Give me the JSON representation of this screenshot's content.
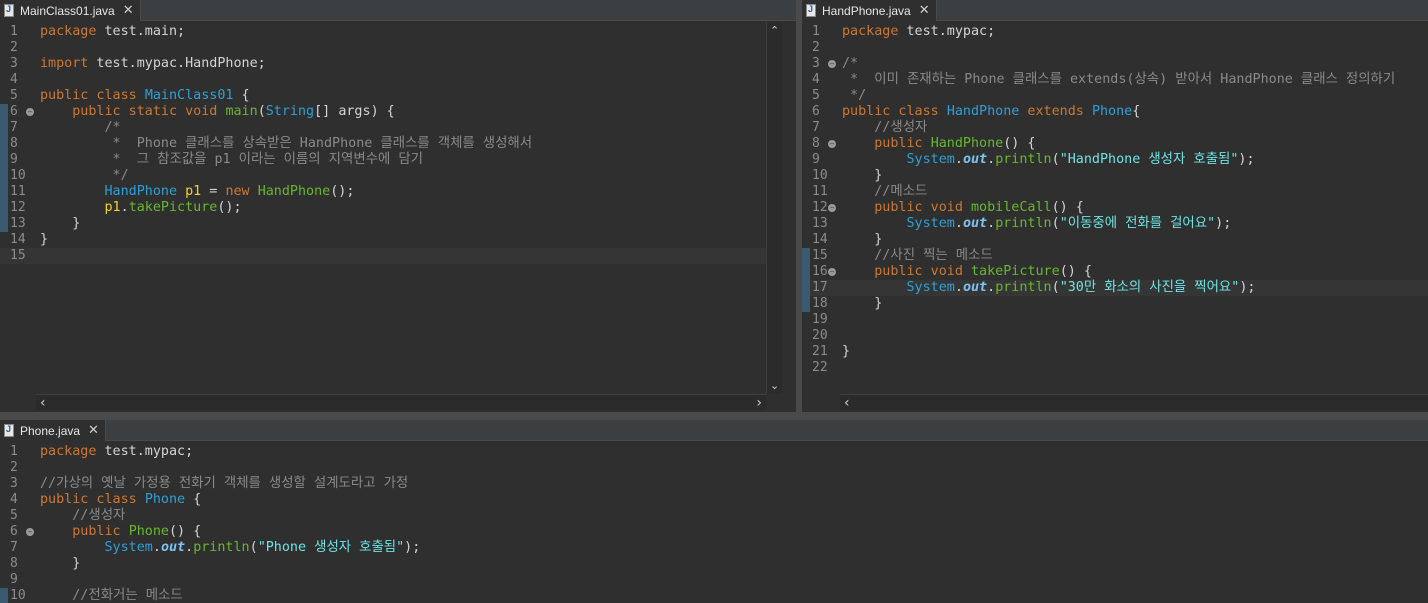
{
  "left_pane": {
    "tab": {
      "label": "MainClass01.java",
      "close": "✕"
    },
    "lines": [
      {
        "n": "1",
        "tokens": [
          {
            "c": "kw",
            "t": "package"
          },
          {
            "c": "pl",
            "t": " test.main;"
          }
        ]
      },
      {
        "n": "2",
        "tokens": []
      },
      {
        "n": "3",
        "tokens": [
          {
            "c": "kw",
            "t": "import"
          },
          {
            "c": "pl",
            "t": " test.mypac.HandPhone;"
          }
        ]
      },
      {
        "n": "4",
        "tokens": []
      },
      {
        "n": "5",
        "tokens": [
          {
            "c": "kw",
            "t": "public class "
          },
          {
            "c": "ty",
            "t": "MainClass01"
          },
          {
            "c": "pl",
            "t": " {"
          }
        ]
      },
      {
        "n": "6",
        "fold": true,
        "mark": true,
        "tokens": [
          {
            "c": "pl",
            "t": "    "
          },
          {
            "c": "kw",
            "t": "public static void "
          },
          {
            "c": "fn",
            "t": "main"
          },
          {
            "c": "pl",
            "t": "("
          },
          {
            "c": "ty",
            "t": "String"
          },
          {
            "c": "pl",
            "t": "[] "
          },
          {
            "c": "id",
            "t": "args"
          },
          {
            "c": "pl",
            "t": ") {"
          }
        ]
      },
      {
        "n": "7",
        "mark": true,
        "tokens": [
          {
            "c": "cm",
            "t": "        /*"
          }
        ]
      },
      {
        "n": "8",
        "mark": true,
        "tokens": [
          {
            "c": "cm",
            "t": "         *  Phone 클래스를 상속받은 HandPhone 클래스를 객체를 생성해서"
          }
        ]
      },
      {
        "n": "9",
        "mark": true,
        "tokens": [
          {
            "c": "cm",
            "t": "         *  그 참조값을 p1 이라는 이름의 지역변수에 담기"
          }
        ]
      },
      {
        "n": "10",
        "mark": true,
        "tokens": [
          {
            "c": "cm",
            "t": "         */"
          }
        ]
      },
      {
        "n": "11",
        "mark": true,
        "tokens": [
          {
            "c": "pl",
            "t": "        "
          },
          {
            "c": "ty",
            "t": "HandPhone"
          },
          {
            "c": "pl",
            "t": " "
          },
          {
            "c": "vr",
            "t": "p1"
          },
          {
            "c": "pl",
            "t": " = "
          },
          {
            "c": "kw",
            "t": "new "
          },
          {
            "c": "fn",
            "t": "HandPhone"
          },
          {
            "c": "pl",
            "t": "();"
          }
        ]
      },
      {
        "n": "12",
        "mark": true,
        "tokens": [
          {
            "c": "pl",
            "t": "        "
          },
          {
            "c": "vr",
            "t": "p1"
          },
          {
            "c": "pl",
            "t": "."
          },
          {
            "c": "fn",
            "t": "takePicture"
          },
          {
            "c": "pl",
            "t": "();"
          }
        ]
      },
      {
        "n": "13",
        "mark": true,
        "tokens": [
          {
            "c": "pl",
            "t": "    }"
          }
        ]
      },
      {
        "n": "14",
        "tokens": [
          {
            "c": "pl",
            "t": "}"
          }
        ]
      },
      {
        "n": "15",
        "current": true,
        "tokens": []
      }
    ]
  },
  "right_pane": {
    "tab": {
      "label": "HandPhone.java",
      "close": "✕"
    },
    "lines": [
      {
        "n": "1",
        "tokens": [
          {
            "c": "kw",
            "t": "package"
          },
          {
            "c": "pl",
            "t": " test.mypac;"
          }
        ]
      },
      {
        "n": "2",
        "tokens": []
      },
      {
        "n": "3",
        "fold": true,
        "tokens": [
          {
            "c": "cm",
            "t": "/*"
          }
        ]
      },
      {
        "n": "4",
        "tokens": [
          {
            "c": "cm",
            "t": " *  이미 존재하는 Phone 클래스를 extends(상속) 받아서 HandPhone 클래스 정의하기"
          }
        ]
      },
      {
        "n": "5",
        "tokens": [
          {
            "c": "cm",
            "t": " */"
          }
        ]
      },
      {
        "n": "6",
        "tokens": [
          {
            "c": "kw",
            "t": "public class "
          },
          {
            "c": "ty",
            "t": "HandPhone"
          },
          {
            "c": "kw",
            "t": " extends "
          },
          {
            "c": "ty",
            "t": "Phone"
          },
          {
            "c": "pl",
            "t": "{"
          }
        ]
      },
      {
        "n": "7",
        "tokens": [
          {
            "c": "cm",
            "t": "    //생성자"
          }
        ]
      },
      {
        "n": "8",
        "fold": true,
        "tokens": [
          {
            "c": "pl",
            "t": "    "
          },
          {
            "c": "kw",
            "t": "public "
          },
          {
            "c": "fn",
            "t": "HandPhone"
          },
          {
            "c": "pl",
            "t": "() {"
          }
        ]
      },
      {
        "n": "9",
        "tokens": [
          {
            "c": "pl",
            "t": "        "
          },
          {
            "c": "ty",
            "t": "System"
          },
          {
            "c": "pl",
            "t": "."
          },
          {
            "c": "it",
            "t": "out"
          },
          {
            "c": "pl",
            "t": "."
          },
          {
            "c": "fn",
            "t": "println"
          },
          {
            "c": "pl",
            "t": "("
          },
          {
            "c": "st",
            "t": "\"HandPhone 생성자 호출됨\""
          },
          {
            "c": "pl",
            "t": ");"
          }
        ]
      },
      {
        "n": "10",
        "tokens": [
          {
            "c": "pl",
            "t": "    }"
          }
        ]
      },
      {
        "n": "11",
        "tokens": [
          {
            "c": "cm",
            "t": "    //메소드"
          }
        ]
      },
      {
        "n": "12",
        "fold": true,
        "tokens": [
          {
            "c": "pl",
            "t": "    "
          },
          {
            "c": "kw",
            "t": "public void "
          },
          {
            "c": "fn",
            "t": "mobileCall"
          },
          {
            "c": "pl",
            "t": "() {"
          }
        ]
      },
      {
        "n": "13",
        "tokens": [
          {
            "c": "pl",
            "t": "        "
          },
          {
            "c": "ty",
            "t": "System"
          },
          {
            "c": "pl",
            "t": "."
          },
          {
            "c": "it",
            "t": "out"
          },
          {
            "c": "pl",
            "t": "."
          },
          {
            "c": "fn",
            "t": "println"
          },
          {
            "c": "pl",
            "t": "("
          },
          {
            "c": "st",
            "t": "\"이동중에 전화를 걸어요\""
          },
          {
            "c": "pl",
            "t": ");"
          }
        ]
      },
      {
        "n": "14",
        "tokens": [
          {
            "c": "pl",
            "t": "    }"
          }
        ]
      },
      {
        "n": "15",
        "mark": true,
        "tokens": [
          {
            "c": "cm",
            "t": "    //사진 찍는 메소드"
          }
        ]
      },
      {
        "n": "16",
        "fold": true,
        "mark": true,
        "tokens": [
          {
            "c": "pl",
            "t": "    "
          },
          {
            "c": "kw",
            "t": "public void "
          },
          {
            "c": "fn",
            "t": "takePicture"
          },
          {
            "c": "pl",
            "t": "() {"
          }
        ]
      },
      {
        "n": "17",
        "mark": true,
        "current": true,
        "tokens": [
          {
            "c": "pl",
            "t": "        "
          },
          {
            "c": "ty",
            "t": "System"
          },
          {
            "c": "pl",
            "t": "."
          },
          {
            "c": "it",
            "t": "out"
          },
          {
            "c": "pl",
            "t": "."
          },
          {
            "c": "fn",
            "t": "println"
          },
          {
            "c": "pl",
            "t": "("
          },
          {
            "c": "st",
            "t": "\"30만 화소의 사진을 찍어요\""
          },
          {
            "c": "pl",
            "t": ");"
          }
        ]
      },
      {
        "n": "18",
        "mark": true,
        "tokens": [
          {
            "c": "pl",
            "t": "    }"
          }
        ]
      },
      {
        "n": "19",
        "tokens": []
      },
      {
        "n": "20",
        "tokens": []
      },
      {
        "n": "21",
        "tokens": [
          {
            "c": "pl",
            "t": "}"
          }
        ]
      },
      {
        "n": "22",
        "tokens": []
      }
    ]
  },
  "bottom_pane": {
    "tab": {
      "label": "Phone.java",
      "close": "✕"
    },
    "lines": [
      {
        "n": "1",
        "tokens": [
          {
            "c": "kw",
            "t": "package"
          },
          {
            "c": "pl",
            "t": " test.mypac;"
          }
        ]
      },
      {
        "n": "2",
        "tokens": []
      },
      {
        "n": "3",
        "tokens": [
          {
            "c": "cm",
            "t": "//가상의 옛날 가정용 전화기 객체를 생성할 설계도라고 가정"
          }
        ]
      },
      {
        "n": "4",
        "tokens": [
          {
            "c": "kw",
            "t": "public class "
          },
          {
            "c": "ty",
            "t": "Phone"
          },
          {
            "c": "pl",
            "t": " {"
          }
        ]
      },
      {
        "n": "5",
        "tokens": [
          {
            "c": "cm",
            "t": "    //생성자"
          }
        ]
      },
      {
        "n": "6",
        "fold": true,
        "tokens": [
          {
            "c": "pl",
            "t": "    "
          },
          {
            "c": "kw",
            "t": "public "
          },
          {
            "c": "fn",
            "t": "Phone"
          },
          {
            "c": "pl",
            "t": "() {"
          }
        ]
      },
      {
        "n": "7",
        "tokens": [
          {
            "c": "pl",
            "t": "        "
          },
          {
            "c": "ty",
            "t": "System"
          },
          {
            "c": "pl",
            "t": "."
          },
          {
            "c": "it",
            "t": "out"
          },
          {
            "c": "pl",
            "t": "."
          },
          {
            "c": "fn",
            "t": "println"
          },
          {
            "c": "pl",
            "t": "("
          },
          {
            "c": "st",
            "t": "\"Phone 생성자 호출됨\""
          },
          {
            "c": "pl",
            "t": ");"
          }
        ]
      },
      {
        "n": "8",
        "tokens": [
          {
            "c": "pl",
            "t": "    }"
          }
        ]
      },
      {
        "n": "9",
        "tokens": []
      },
      {
        "n": "10",
        "mark": true,
        "tokens": [
          {
            "c": "cm",
            "t": "    //전화거는 메소드"
          }
        ]
      }
    ]
  },
  "scroll": {
    "up": "⌃",
    "down": "⌄",
    "left": "‹",
    "right": "›"
  }
}
